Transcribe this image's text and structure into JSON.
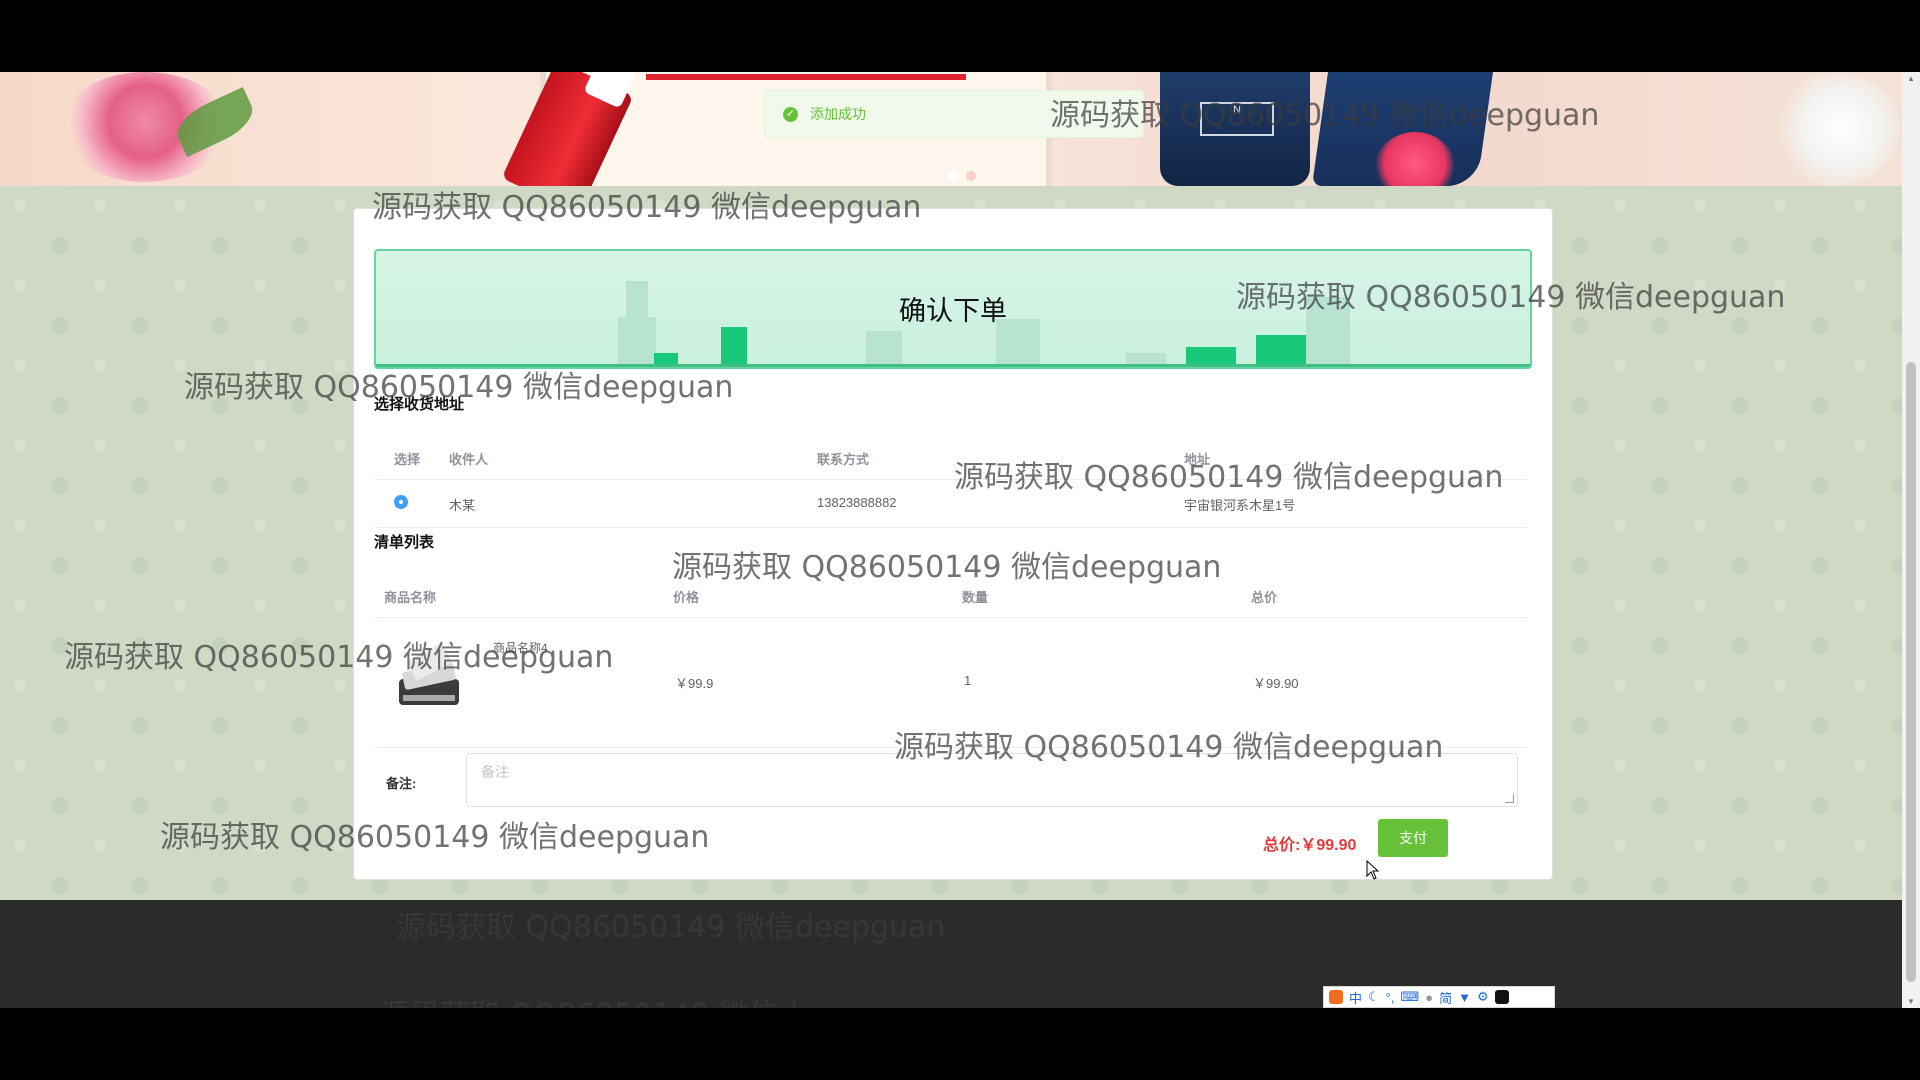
{
  "toast": {
    "message": "添加成功"
  },
  "page": {
    "title": "确认下单"
  },
  "address": {
    "section_title": "选择收货地址",
    "headers": {
      "select": "选择",
      "receiver": "收件人",
      "contact": "联系方式",
      "address": "地址"
    },
    "rows": [
      {
        "receiver": "木某",
        "contact": "13823888882",
        "address": "宇宙银河系木星1号",
        "selected": true
      }
    ]
  },
  "items": {
    "section_title": "清单列表",
    "headers": {
      "name": "商品名称",
      "price": "价格",
      "quantity": "数量",
      "total": "总价"
    },
    "rows": [
      {
        "name": "商品名称4",
        "price": "￥99.9",
        "quantity": "1",
        "total": "￥99.90",
        "image": "scanner-product-image"
      }
    ]
  },
  "remark": {
    "label": "备注:",
    "placeholder": "备注"
  },
  "summary": {
    "total_label": "总价:",
    "total_value": "￥99.90",
    "pay_label": "支付"
  },
  "ime": {
    "chars": [
      "中",
      "简"
    ]
  },
  "watermark": "源码获取 QQ86050149 微信deepguan",
  "colors": {
    "accent_green": "#67c23a",
    "price_red": "#e4393c",
    "hero_border": "#65d4a0"
  }
}
